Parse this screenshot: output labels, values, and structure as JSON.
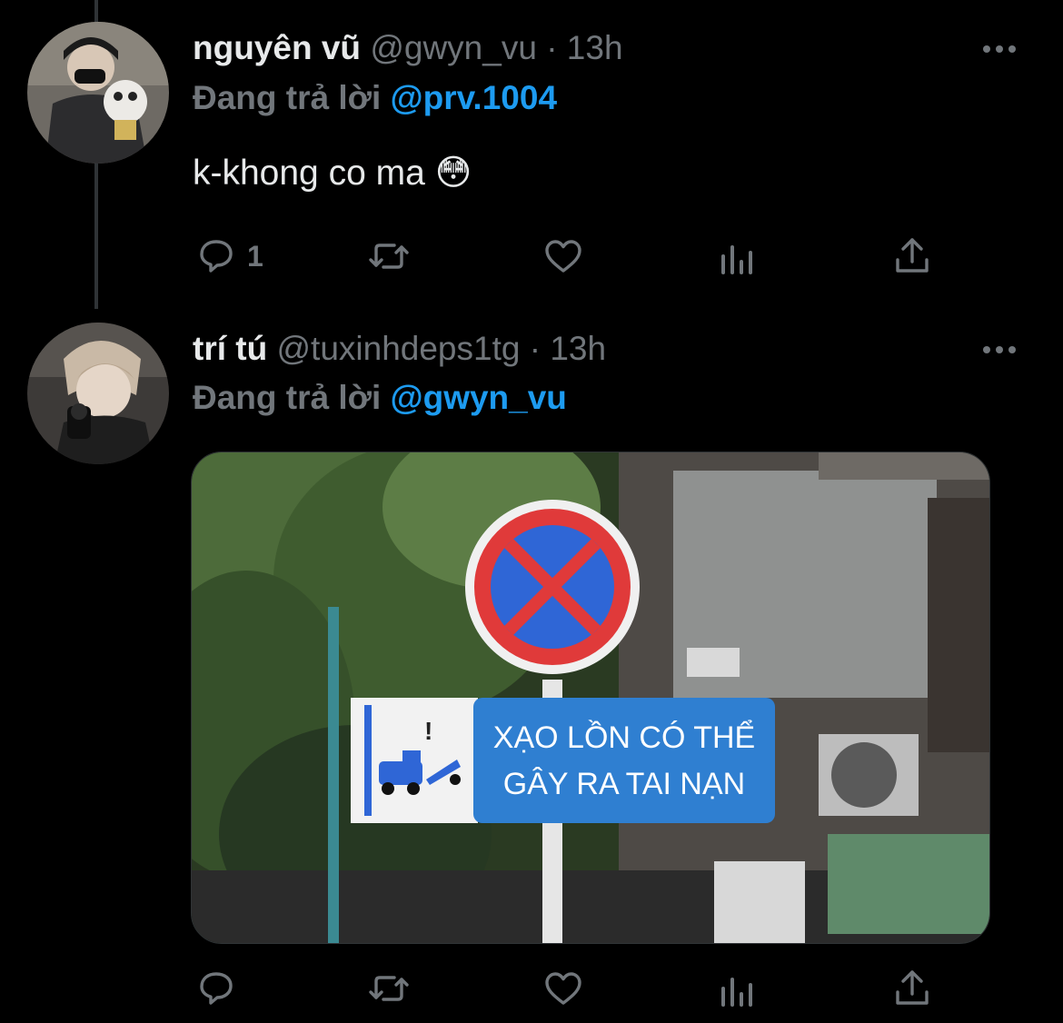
{
  "tweets": [
    {
      "name": "nguyên vũ",
      "handle": "@gwyn_vu",
      "separator": "·",
      "time": "13h",
      "reply_prefix": "Đang trả lời",
      "reply_to": "@prv.1004",
      "text": "k-khong co ma 😳",
      "reply_count": "1",
      "more_icon": "more-horizontal-icon"
    },
    {
      "name": "trí tú",
      "handle": "@tuxinhdeps1tg",
      "separator": "·",
      "time": "13h",
      "reply_prefix": "Đang trả lời",
      "reply_to": "@gwyn_vu",
      "more_icon": "more-horizontal-icon",
      "image": {
        "sign_text_line1": "XẠO LỒN CÓ THỂ",
        "sign_text_line2": "GÂY RA TAI NẠN",
        "warning_mark": "!"
      }
    }
  ],
  "colors": {
    "background": "#000000",
    "name": "#e7e9ea",
    "secondary": "#71767b",
    "mention": "#1d9bf0"
  }
}
